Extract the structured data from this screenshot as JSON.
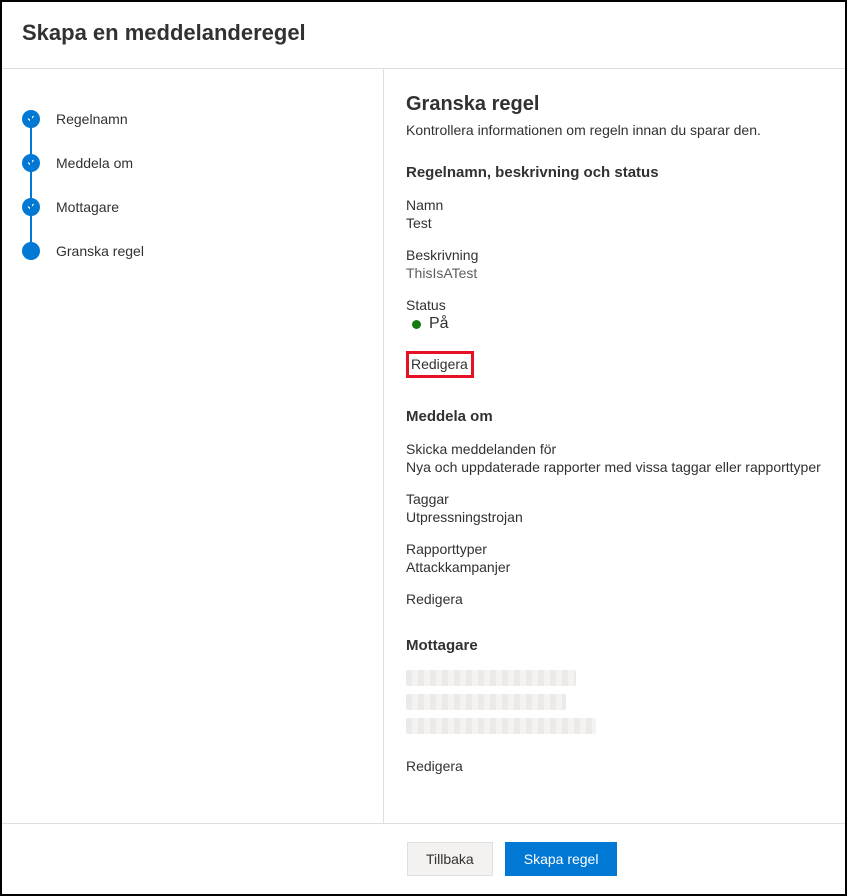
{
  "header": {
    "title": "Skapa en meddelanderegel"
  },
  "sidebar": {
    "steps": [
      {
        "label": "Regelnamn"
      },
      {
        "label": "Meddela om"
      },
      {
        "label": "Mottagare"
      },
      {
        "label": "Granska regel"
      }
    ]
  },
  "review": {
    "title": "Granska regel",
    "subtitle": "Kontrollera informationen om regeln innan du sparar den.",
    "section1": {
      "heading": "Regelnamn, beskrivning och status",
      "name_label": "Namn",
      "name_value": "Test",
      "desc_label": "Beskrivning",
      "desc_value": "ThisIsATest",
      "status_label": "Status",
      "status_value": "På",
      "edit": "Redigera"
    },
    "section2": {
      "heading": "Meddela om",
      "send_label": "Skicka meddelanden för",
      "send_value": "Nya och uppdaterade rapporter med vissa taggar eller rapporttyper",
      "tags_label": "Taggar",
      "tags_value": "Utpressningstrojan",
      "types_label": "Rapporttyper",
      "types_value": "Attackkampanjer",
      "edit": "Redigera"
    },
    "section3": {
      "heading": "Mottagare",
      "edit": "Redigera"
    }
  },
  "footer": {
    "back": "Tillbaka",
    "create": "Skapa regel"
  }
}
